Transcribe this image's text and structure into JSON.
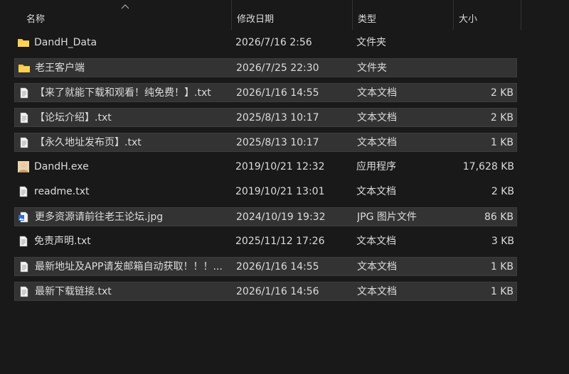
{
  "columns": {
    "name": "名称",
    "date": "修改日期",
    "type": "类型",
    "size": "大小"
  },
  "files": [
    {
      "name": "DandH_Data",
      "date": "2026/7/16 2:56",
      "type": "文件夹",
      "size": "",
      "icon": "folder-icon",
      "selected": false
    },
    {
      "name": "老王客户端",
      "date": "2026/7/25 22:30",
      "type": "文件夹",
      "size": "",
      "icon": "folder-icon",
      "selected": true
    },
    {
      "name": "【来了就能下载和观看！纯免费！】.txt",
      "date": "2026/1/16 14:55",
      "type": "文本文档",
      "size": "2 KB",
      "icon": "text-file-icon",
      "selected": true
    },
    {
      "name": "【论坛介绍】.txt",
      "date": "2025/8/13 10:17",
      "type": "文本文档",
      "size": "2 KB",
      "icon": "text-file-icon",
      "selected": true
    },
    {
      "name": "【永久地址发布页】.txt",
      "date": "2025/8/13 10:17",
      "type": "文本文档",
      "size": "1 KB",
      "icon": "text-file-icon",
      "selected": true
    },
    {
      "name": "DandH.exe",
      "date": "2019/10/21 12:32",
      "type": "应用程序",
      "size": "17,628 KB",
      "icon": "app-icon",
      "selected": false
    },
    {
      "name": "readme.txt",
      "date": "2019/10/21 13:01",
      "type": "文本文档",
      "size": "2 KB",
      "icon": "text-file-icon",
      "selected": false
    },
    {
      "name": "更多资源请前往老王论坛.jpg",
      "date": "2024/10/19 19:32",
      "type": "JPG 图片文件",
      "size": "86 KB",
      "icon": "image-file-icon",
      "selected": true
    },
    {
      "name": "免责声明.txt",
      "date": "2025/11/12 17:26",
      "type": "文本文档",
      "size": "3 KB",
      "icon": "text-file-icon",
      "selected": false
    },
    {
      "name": "最新地址及APP请发邮箱自动获取！！！...",
      "date": "2026/1/16 14:55",
      "type": "文本文档",
      "size": "1 KB",
      "icon": "text-file-icon",
      "selected": true
    },
    {
      "name": "最新下载链接.txt",
      "date": "2026/1/16 14:56",
      "type": "文本文档",
      "size": "1 KB",
      "icon": "text-file-icon",
      "selected": true
    }
  ],
  "colors": {
    "background": "#191919",
    "selected_row": "#333333",
    "folder": "#f5c542",
    "text": "#dcdcdc"
  }
}
